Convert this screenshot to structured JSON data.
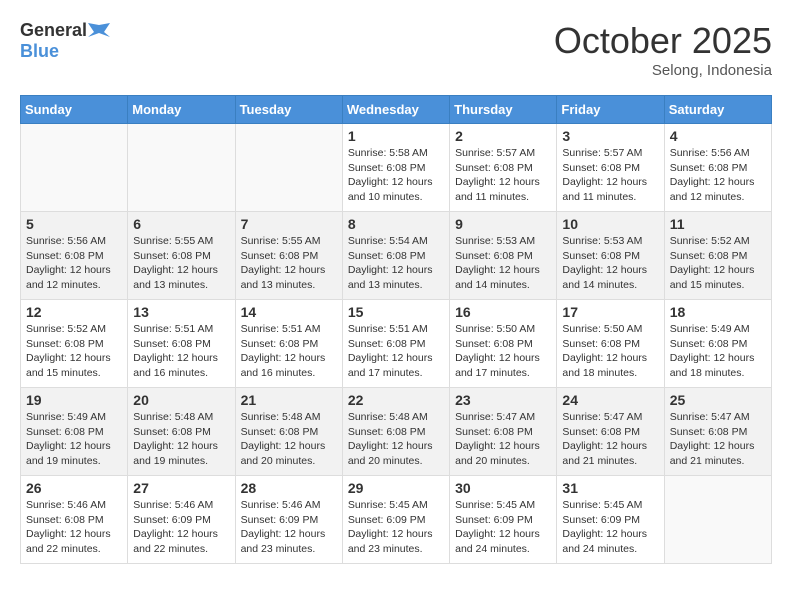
{
  "header": {
    "logo_general": "General",
    "logo_blue": "Blue",
    "month": "October 2025",
    "location": "Selong, Indonesia"
  },
  "weekdays": [
    "Sunday",
    "Monday",
    "Tuesday",
    "Wednesday",
    "Thursday",
    "Friday",
    "Saturday"
  ],
  "weeks": [
    [
      {
        "day": "",
        "info": ""
      },
      {
        "day": "",
        "info": ""
      },
      {
        "day": "",
        "info": ""
      },
      {
        "day": "1",
        "info": "Sunrise: 5:58 AM\nSunset: 6:08 PM\nDaylight: 12 hours\nand 10 minutes."
      },
      {
        "day": "2",
        "info": "Sunrise: 5:57 AM\nSunset: 6:08 PM\nDaylight: 12 hours\nand 11 minutes."
      },
      {
        "day": "3",
        "info": "Sunrise: 5:57 AM\nSunset: 6:08 PM\nDaylight: 12 hours\nand 11 minutes."
      },
      {
        "day": "4",
        "info": "Sunrise: 5:56 AM\nSunset: 6:08 PM\nDaylight: 12 hours\nand 12 minutes."
      }
    ],
    [
      {
        "day": "5",
        "info": "Sunrise: 5:56 AM\nSunset: 6:08 PM\nDaylight: 12 hours\nand 12 minutes."
      },
      {
        "day": "6",
        "info": "Sunrise: 5:55 AM\nSunset: 6:08 PM\nDaylight: 12 hours\nand 13 minutes."
      },
      {
        "day": "7",
        "info": "Sunrise: 5:55 AM\nSunset: 6:08 PM\nDaylight: 12 hours\nand 13 minutes."
      },
      {
        "day": "8",
        "info": "Sunrise: 5:54 AM\nSunset: 6:08 PM\nDaylight: 12 hours\nand 13 minutes."
      },
      {
        "day": "9",
        "info": "Sunrise: 5:53 AM\nSunset: 6:08 PM\nDaylight: 12 hours\nand 14 minutes."
      },
      {
        "day": "10",
        "info": "Sunrise: 5:53 AM\nSunset: 6:08 PM\nDaylight: 12 hours\nand 14 minutes."
      },
      {
        "day": "11",
        "info": "Sunrise: 5:52 AM\nSunset: 6:08 PM\nDaylight: 12 hours\nand 15 minutes."
      }
    ],
    [
      {
        "day": "12",
        "info": "Sunrise: 5:52 AM\nSunset: 6:08 PM\nDaylight: 12 hours\nand 15 minutes."
      },
      {
        "day": "13",
        "info": "Sunrise: 5:51 AM\nSunset: 6:08 PM\nDaylight: 12 hours\nand 16 minutes."
      },
      {
        "day": "14",
        "info": "Sunrise: 5:51 AM\nSunset: 6:08 PM\nDaylight: 12 hours\nand 16 minutes."
      },
      {
        "day": "15",
        "info": "Sunrise: 5:51 AM\nSunset: 6:08 PM\nDaylight: 12 hours\nand 17 minutes."
      },
      {
        "day": "16",
        "info": "Sunrise: 5:50 AM\nSunset: 6:08 PM\nDaylight: 12 hours\nand 17 minutes."
      },
      {
        "day": "17",
        "info": "Sunrise: 5:50 AM\nSunset: 6:08 PM\nDaylight: 12 hours\nand 18 minutes."
      },
      {
        "day": "18",
        "info": "Sunrise: 5:49 AM\nSunset: 6:08 PM\nDaylight: 12 hours\nand 18 minutes."
      }
    ],
    [
      {
        "day": "19",
        "info": "Sunrise: 5:49 AM\nSunset: 6:08 PM\nDaylight: 12 hours\nand 19 minutes."
      },
      {
        "day": "20",
        "info": "Sunrise: 5:48 AM\nSunset: 6:08 PM\nDaylight: 12 hours\nand 19 minutes."
      },
      {
        "day": "21",
        "info": "Sunrise: 5:48 AM\nSunset: 6:08 PM\nDaylight: 12 hours\nand 20 minutes."
      },
      {
        "day": "22",
        "info": "Sunrise: 5:48 AM\nSunset: 6:08 PM\nDaylight: 12 hours\nand 20 minutes."
      },
      {
        "day": "23",
        "info": "Sunrise: 5:47 AM\nSunset: 6:08 PM\nDaylight: 12 hours\nand 20 minutes."
      },
      {
        "day": "24",
        "info": "Sunrise: 5:47 AM\nSunset: 6:08 PM\nDaylight: 12 hours\nand 21 minutes."
      },
      {
        "day": "25",
        "info": "Sunrise: 5:47 AM\nSunset: 6:08 PM\nDaylight: 12 hours\nand 21 minutes."
      }
    ],
    [
      {
        "day": "26",
        "info": "Sunrise: 5:46 AM\nSunset: 6:08 PM\nDaylight: 12 hours\nand 22 minutes."
      },
      {
        "day": "27",
        "info": "Sunrise: 5:46 AM\nSunset: 6:09 PM\nDaylight: 12 hours\nand 22 minutes."
      },
      {
        "day": "28",
        "info": "Sunrise: 5:46 AM\nSunset: 6:09 PM\nDaylight: 12 hours\nand 23 minutes."
      },
      {
        "day": "29",
        "info": "Sunrise: 5:45 AM\nSunset: 6:09 PM\nDaylight: 12 hours\nand 23 minutes."
      },
      {
        "day": "30",
        "info": "Sunrise: 5:45 AM\nSunset: 6:09 PM\nDaylight: 12 hours\nand 24 minutes."
      },
      {
        "day": "31",
        "info": "Sunrise: 5:45 AM\nSunset: 6:09 PM\nDaylight: 12 hours\nand 24 minutes."
      },
      {
        "day": "",
        "info": ""
      }
    ]
  ]
}
